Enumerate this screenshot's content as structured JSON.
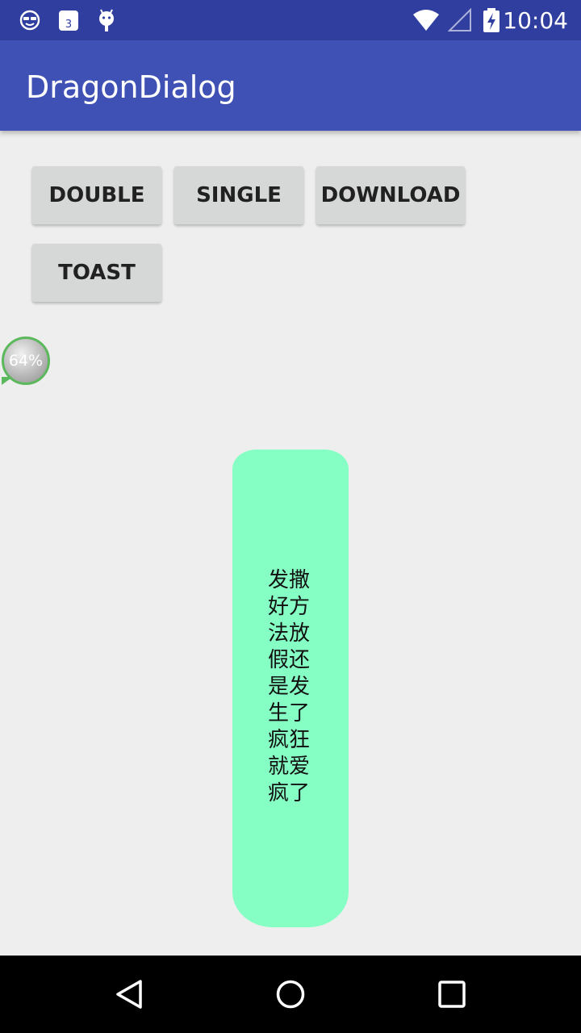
{
  "status_bar": {
    "time": "10:04",
    "icons": [
      "face-icon",
      "calendar-icon",
      "android-icon",
      "wifi-icon",
      "signal-icon",
      "battery-icon"
    ]
  },
  "app_bar": {
    "title": "DragonDialog"
  },
  "buttons": {
    "double": "DOUBLE",
    "single": "SINGLE",
    "download": "DOWNLOAD",
    "toast": "TOAST"
  },
  "progress_bubble": {
    "label": "64%",
    "value": 0.64,
    "ring_color": "#5cb85c"
  },
  "toast": {
    "message": "发撒好方法放假还是发生了疯狂就爱疯了",
    "background": "#86ffc4"
  },
  "colors": {
    "primary": "#3f51b5",
    "primary_dark": "#303f9f",
    "background": "#eeeeee"
  }
}
